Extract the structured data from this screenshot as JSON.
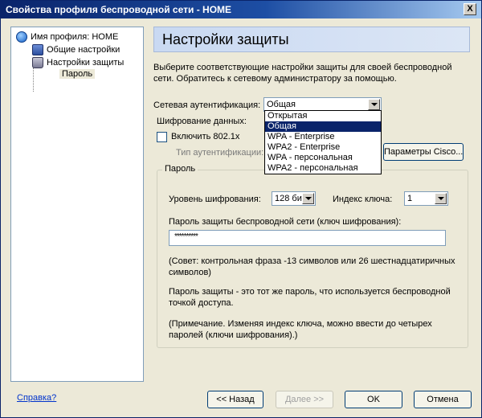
{
  "window": {
    "title": "Свойства профиля беспроводной сети - HOME",
    "close_label": "X"
  },
  "tree": {
    "items": [
      {
        "label": "Имя профиля: HOME",
        "icon": "profile-icon"
      },
      {
        "label": "Общие настройки",
        "icon": "settings-icon"
      },
      {
        "label": "Настройки защиты",
        "icon": "lock-icon"
      },
      {
        "label": "Пароль",
        "icon": ""
      }
    ]
  },
  "main": {
    "heading": "Настройки защиты",
    "intro": "Выберите соответствующие настройки защиты для своей беспроводной сети. Обратитесь к сетевому администратору за помощью.",
    "network_auth_label": "Сетевая аутентификация:",
    "network_auth_value": "Общая",
    "auth_options": [
      "Открытая",
      "Общая",
      "WPA - Enterprise",
      "WPA2 - Enterprise",
      "WPA - персональная",
      "WPA2 - персональная"
    ],
    "auth_selected_index": 1,
    "encryption_label": "Шифрование данных:",
    "enable_8021x_label": "Включить 802.1x",
    "enable_8021x_checked": false,
    "auth_type_label": "Тип аутентификации:",
    "cisco_button": "Параметры Cisco...",
    "password_group": {
      "title": "Пароль",
      "encryption_level_label": "Уровень шифрования:",
      "encryption_level_value": "128 би",
      "key_index_label": "Индекс ключа:",
      "key_index_value": "1",
      "key_label": "Пароль защиты беспроводной сети (ключ шифрования):",
      "key_value": "**********",
      "hint": "(Совет: контрольная фраза -13 символов или 26 шестнадцатиричных символов)",
      "info": "Пароль защиты - это тот же пароль, что используется беспроводной точкой доступа.",
      "note": "(Примечание. Изменяя индекс ключа, можно ввести до четырех паролей (ключи шифрования).)"
    }
  },
  "footer": {
    "help": "Справка?",
    "back": "<< Назад",
    "next": "Далее >>",
    "ok": "OK",
    "cancel": "Отмена"
  }
}
